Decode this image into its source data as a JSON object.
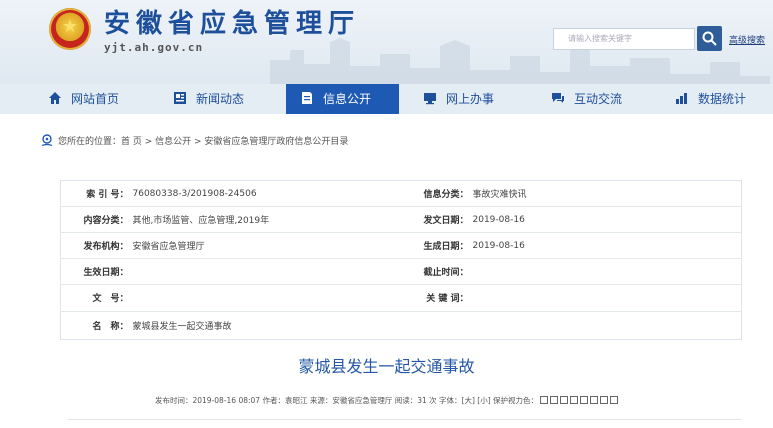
{
  "header": {
    "site_title": "安徽省应急管理厅",
    "site_domain": "yjt.ah.gov.cn",
    "search_placeholder": "请输入搜索关键字",
    "advanced_search": "高级搜索"
  },
  "nav": {
    "items": [
      {
        "label": "网站首页",
        "icon": "home-icon"
      },
      {
        "label": "新闻动态",
        "icon": "newspaper-icon"
      },
      {
        "label": "信息公开",
        "icon": "document-icon",
        "active": true
      },
      {
        "label": "网上办事",
        "icon": "monitor-icon"
      },
      {
        "label": "互动交流",
        "icon": "chat-icon"
      },
      {
        "label": "数据统计",
        "icon": "chart-icon"
      }
    ],
    "accent": "#1e59b4"
  },
  "breadcrumb": {
    "text": "您所在的位置：首 页 > 信息公开 > 安徽省应急管理厅政府信息公开目录"
  },
  "info": {
    "index_no_label": "索 引 号：",
    "index_no": "76080338-3/201908-24506",
    "category_label": "信息分类：",
    "category": "事故灾难快讯",
    "content_class_label": "内容分类：",
    "content_class": "其他,市场监管、应急管理,2019年",
    "issue_date_label": "发文日期：",
    "issue_date": "2019-08-16",
    "publisher_label": "发布机构：",
    "publisher": "安徽省应急管理厅",
    "created_date_label": "生成日期：",
    "created_date": "2019-08-16",
    "effective_date_label": "生效日期：",
    "effective_date": "",
    "expiry_label": "截止时间：",
    "expiry": "",
    "doc_no_label": "文　号：",
    "doc_no": "",
    "keywords_label": "关 键 词：",
    "keywords": "",
    "name_label": "名　称：",
    "name": "蒙城县发生一起交通事故"
  },
  "article": {
    "title": "蒙城县发生一起交通事故",
    "meta_text": "发布时间：2019-08-16 08:07  作者：袁昭江  来源：安徽省应急管理厅  阅读：31 次  字体：[大] [小]  保护视力色："
  }
}
